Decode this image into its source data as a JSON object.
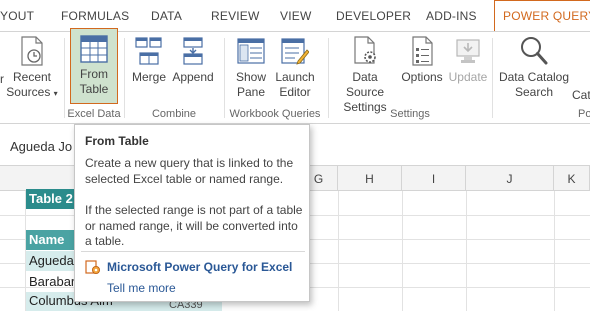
{
  "tabs": [
    "YOUT",
    "FORMULAS",
    "DATA",
    "REVIEW",
    "VIEW",
    "DEVELOPER",
    "ADD-INS",
    "POWER QUERY"
  ],
  "ribbon": {
    "recent_sources": {
      "line1": "Recent",
      "line2": "Sources",
      "arrow": "▾"
    },
    "from_table": {
      "line1": "From",
      "line2": "Table"
    },
    "merge": "Merge",
    "append": "Append",
    "show_pane": {
      "line1": "Show",
      "line2": "Pane"
    },
    "launch_editor": {
      "line1": "Launch",
      "line2": "Editor"
    },
    "data_source_settings": {
      "line1": "Data Source",
      "line2": "Settings"
    },
    "options": "Options",
    "update": "Update",
    "data_catalog_search": {
      "line1": "Data Catalog",
      "line2": "Search"
    },
    "partial_right": "Cat",
    "partial_left": "r",
    "groups": {
      "excel_data": "Excel Data",
      "combine": "Combine",
      "workbook_queries": "Workbook Queries",
      "settings": "Settings",
      "partial": "Po"
    }
  },
  "name_box": "Agueda Jo",
  "columns": [
    "G",
    "H",
    "I",
    "J",
    "K"
  ],
  "cells": {
    "table_title": "Table 2",
    "header_name": "Name",
    "rows": [
      "Agueda",
      "Barabar",
      "Columbus Alm"
    ],
    "partial_cell": "CA339"
  },
  "tooltip": {
    "title": "From Table",
    "description": "Create a new query that is linked to the selected Excel table or named range.",
    "note": "If the selected range is not part of a table or named range, it will be converted into a table.",
    "addin_name": "Microsoft Power Query for Excel",
    "more_link": "Tell me more"
  },
  "colors": {
    "accent": "#d2691e",
    "table_title": "#2b8c8c",
    "table_header": "#4aa3a3",
    "table_band": "#d6ecec",
    "link": "#2a5896"
  }
}
